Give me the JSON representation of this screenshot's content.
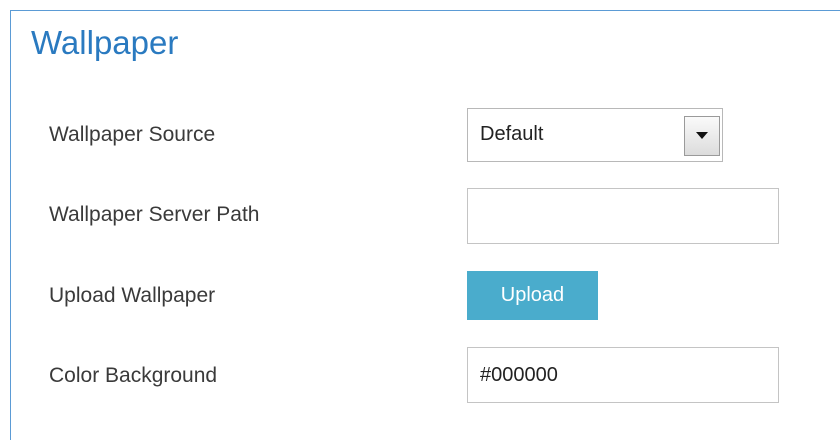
{
  "panel": {
    "title": "Wallpaper"
  },
  "fields": {
    "wallpaper_source": {
      "label": "Wallpaper Source",
      "selected": "Default"
    },
    "wallpaper_server_path": {
      "label": "Wallpaper Server Path",
      "value": ""
    },
    "upload_wallpaper": {
      "label": "Upload Wallpaper",
      "button_label": "Upload"
    },
    "color_background": {
      "label": "Color Background",
      "value": "#000000"
    }
  },
  "colors": {
    "title": "#2a7ac0",
    "panel_border": "#5b9bd5",
    "upload_button": "#4aaccc"
  },
  "icons": {
    "select_arrow": "chevron-down-icon"
  }
}
